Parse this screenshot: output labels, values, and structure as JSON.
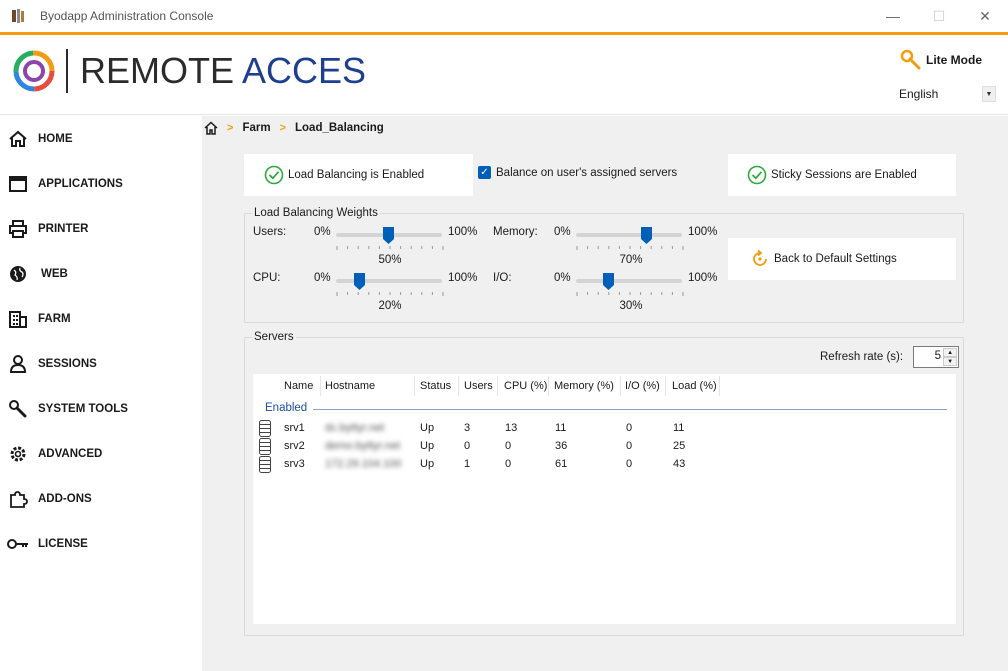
{
  "window": {
    "title": "Byodapp Administration Console",
    "minimize": "—",
    "maximize": "☐",
    "close": "✕"
  },
  "brand": {
    "word1": "REMOTE",
    "word2": "ACCES",
    "colors": {
      "accent": "#f39c12",
      "brand_blue": "#1e3f8f",
      "selection": "#005fb8"
    }
  },
  "header": {
    "lite_mode": "Lite Mode",
    "language": "English"
  },
  "sidebar": {
    "items": [
      {
        "label": "HOME",
        "icon": "home-icon"
      },
      {
        "label": "APPLICATIONS",
        "icon": "window-icon"
      },
      {
        "label": "PRINTER",
        "icon": "printer-icon"
      },
      {
        "label": "WEB",
        "icon": "globe-icon"
      },
      {
        "label": "FARM",
        "icon": "building-icon"
      },
      {
        "label": "SESSIONS",
        "icon": "user-icon"
      },
      {
        "label": "SYSTEM TOOLS",
        "icon": "wrench-icon"
      },
      {
        "label": "ADVANCED",
        "icon": "gear-icon"
      },
      {
        "label": "ADD-ONS",
        "icon": "puzzle-icon"
      },
      {
        "label": "LICENSE",
        "icon": "key-icon"
      }
    ]
  },
  "breadcrumb": {
    "items": [
      "Farm",
      "Load_Balancing"
    ]
  },
  "status": {
    "lb_enabled": "Load Balancing is Enabled",
    "balance_assigned": "Balance on user's assigned servers",
    "balance_checked": true,
    "sticky": "Sticky Sessions are Enabled"
  },
  "weights": {
    "legend": "Load Balancing Weights",
    "min_label": "0%",
    "max_label": "100%",
    "sliders": [
      {
        "label": "Users:",
        "value": 50,
        "value_text": "50%"
      },
      {
        "label": "Memory:",
        "value": 70,
        "value_text": "70%"
      },
      {
        "label": "CPU:",
        "value": 20,
        "value_text": "20%"
      },
      {
        "label": "I/O:",
        "value": 30,
        "value_text": "30%"
      }
    ],
    "back_default": "Back to Default Settings"
  },
  "servers": {
    "legend": "Servers",
    "refresh_label": "Refresh rate (s):",
    "refresh_value": "5",
    "columns": [
      "Name",
      "Hostname",
      "Status",
      "Users",
      "CPU (%)",
      "Memory (%)",
      "I/O (%)",
      "Load (%)"
    ],
    "group": "Enabled",
    "rows": [
      {
        "name": "srv1",
        "hostname": "dc.byttyr.net",
        "status": "Up",
        "users": "3",
        "cpu": "13",
        "memory": "11",
        "io": "0",
        "load": "11"
      },
      {
        "name": "srv2",
        "hostname": "demo.byttyr.net",
        "status": "Up",
        "users": "0",
        "cpu": "0",
        "memory": "36",
        "io": "0",
        "load": "25"
      },
      {
        "name": "srv3",
        "hostname": "172.29.104.100",
        "status": "Up",
        "users": "1",
        "cpu": "0",
        "memory": "61",
        "io": "0",
        "load": "43"
      }
    ]
  }
}
